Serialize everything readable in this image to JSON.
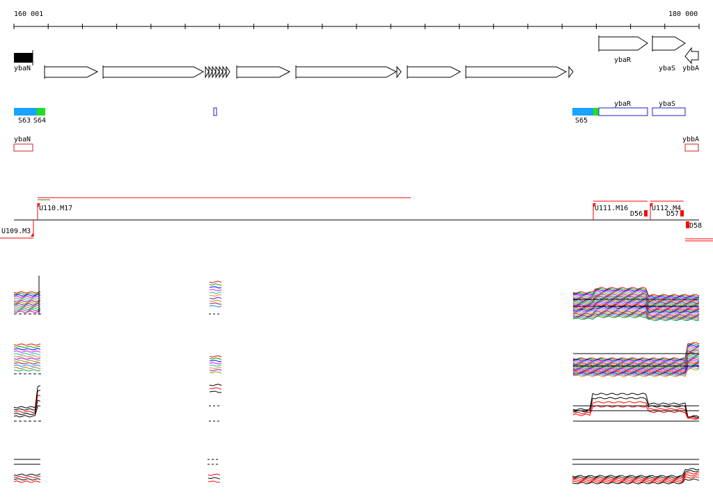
{
  "ruler": {
    "start_label": "160 001",
    "end_label": "180 000"
  },
  "genes": {
    "ybaR": "ybaR",
    "ybaS": "ybaS",
    "ybbA": "ybbA",
    "ybaN": "ybaN"
  },
  "segments": {
    "S63": "S63",
    "S64": "S64",
    "S65": "S65"
  },
  "annotation_boxes": {
    "ybaR": "ybaR",
    "ybaS": "ybaS",
    "ybaN": "ybaN",
    "ybbA": "ybbA"
  },
  "transcription_units": {
    "U109": "U109.M3",
    "U110": "U110.M17",
    "U111": "U111.M16",
    "U112": "U112.M4",
    "D56": "D56",
    "D57": "D57",
    "D58": "D58"
  },
  "colors": {
    "segment_blue": "#1aa3ff",
    "segment_green": "#22dd22",
    "box_blue": "#1c1ccc",
    "box_red": "#cc2222",
    "accent_red": "#ff0000",
    "gene_black": "#000000"
  }
}
